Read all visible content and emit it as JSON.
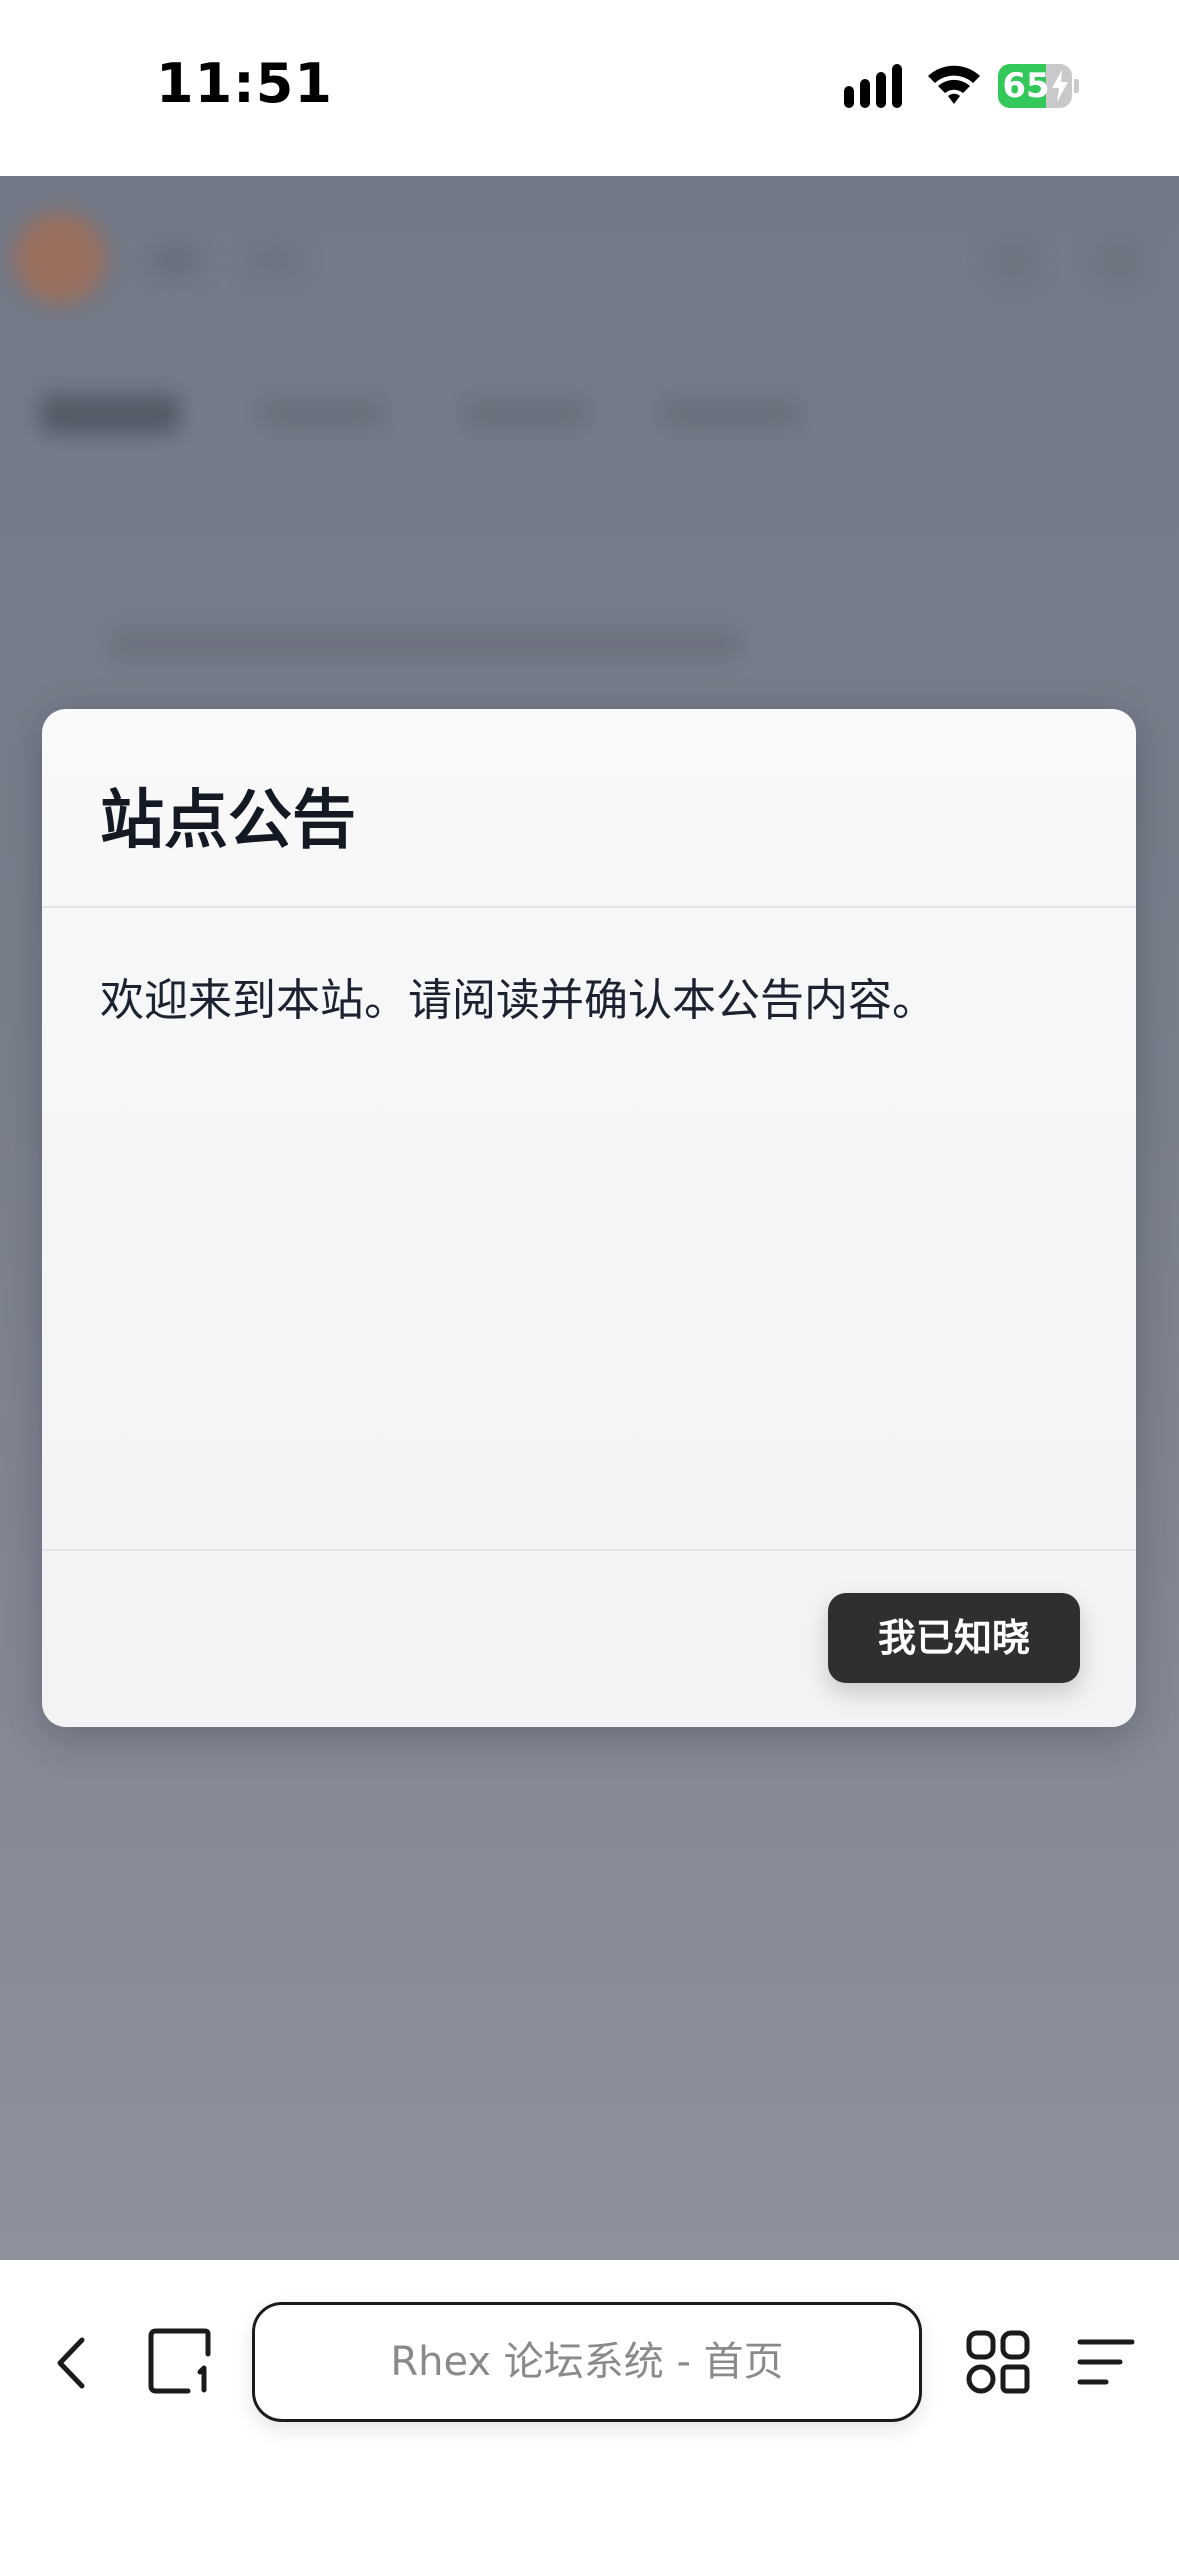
{
  "status_bar": {
    "time": "11:51",
    "battery_level": "65",
    "battery_fraction": 0.65,
    "charging": true,
    "icons": [
      "signal-icon",
      "wifi-icon",
      "battery-icon",
      "bolt-icon"
    ]
  },
  "dialog": {
    "title": "站点公告",
    "message": "欢迎来到本站。请阅读并确认本公告内容。",
    "confirm_label": "我已知晓"
  },
  "browser_bar": {
    "address_text": "Rhex 论坛系统 - 首页",
    "icons": [
      "back-icon",
      "tabs-icon",
      "grid-icon",
      "menu-icon"
    ]
  },
  "colors": {
    "overlay": "#7a7f8c",
    "battery_green": "#34c759",
    "button_dark": "#2f2f2f",
    "title_text": "#141a24"
  }
}
